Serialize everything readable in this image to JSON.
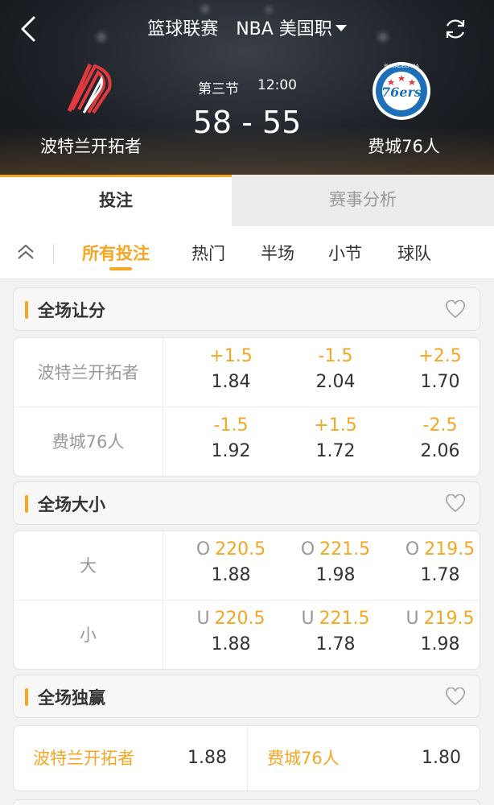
{
  "header": {
    "title_sport": "篮球联赛",
    "title_league": "NBA 美国职",
    "period": "第三节",
    "clock": "12:00",
    "score": "58 - 55",
    "home_team": "波特兰开拓者",
    "away_team": "费城76人",
    "away_logo_text": "76ers",
    "away_logo_ring_text": "PHILADELPHIA",
    "colors": {
      "accent": "#f5a623",
      "blazers_red": "#e03a3e",
      "sixers_blue": "#1d6fb8"
    }
  },
  "tabs": [
    {
      "label": "投注",
      "active": true
    },
    {
      "label": "赛事分析",
      "active": false
    }
  ],
  "filters": [
    "所有投注",
    "热门",
    "半场",
    "小节",
    "球队"
  ],
  "handicap": {
    "title": "全场让分",
    "rows": [
      {
        "team": "波特兰开拓者",
        "cells": [
          {
            "line": "+1.5",
            "odds": "1.84"
          },
          {
            "line": "-1.5",
            "odds": "2.04"
          },
          {
            "line": "+2.5",
            "odds": "1.70"
          }
        ]
      },
      {
        "team": "费城76人",
        "cells": [
          {
            "line": "-1.5",
            "odds": "1.92"
          },
          {
            "line": "+1.5",
            "odds": "1.72"
          },
          {
            "line": "-2.5",
            "odds": "2.06"
          }
        ]
      }
    ]
  },
  "totals": {
    "title": "全场大小",
    "rows": [
      {
        "team": "大",
        "cells": [
          {
            "prefix": "O",
            "line": "220.5",
            "odds": "1.88"
          },
          {
            "prefix": "O",
            "line": "221.5",
            "odds": "1.98"
          },
          {
            "prefix": "O",
            "line": "219.5",
            "odds": "1.78"
          }
        ]
      },
      {
        "team": "小",
        "cells": [
          {
            "prefix": "U",
            "line": "220.5",
            "odds": "1.88"
          },
          {
            "prefix": "U",
            "line": "221.5",
            "odds": "1.78"
          },
          {
            "prefix": "U",
            "line": "219.5",
            "odds": "1.98"
          }
        ]
      }
    ]
  },
  "moneyline": {
    "title": "全场独赢",
    "home": {
      "team": "波特兰开拓者",
      "odds": "1.88"
    },
    "away": {
      "team": "费城76人",
      "odds": "1.80"
    }
  }
}
